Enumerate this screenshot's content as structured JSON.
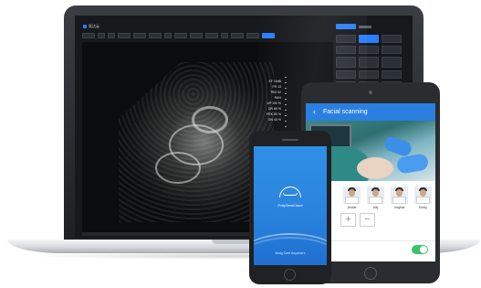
{
  "laptop": {
    "app_title": "医达云",
    "toolbar_buttons": 14,
    "scan_readout": [
      "SF 16dB",
      "FR 13",
      "TBD 52",
      "RAH",
      "AP 100 %",
      "DR 65 %",
      "FRK 80 %",
      "GN 40 %"
    ],
    "accent_color": "#2a7fff"
  },
  "tablet": {
    "header_title": "Facial scanning",
    "back_glyph": "‹",
    "participants": [
      {
        "name": "Jessie"
      },
      {
        "name": "Ally"
      },
      {
        "name": "Virginia"
      },
      {
        "name": "Emily"
      }
    ],
    "zoom_in_glyph": "+",
    "zoom_out_glyph": "−",
    "toggle_on": true,
    "accent_color": "#2a7fe0"
  },
  "phone": {
    "brand": "PolyGemCloud",
    "footer_text": "Bring Care Anywhere",
    "accent_color": "#2f8fe6"
  }
}
